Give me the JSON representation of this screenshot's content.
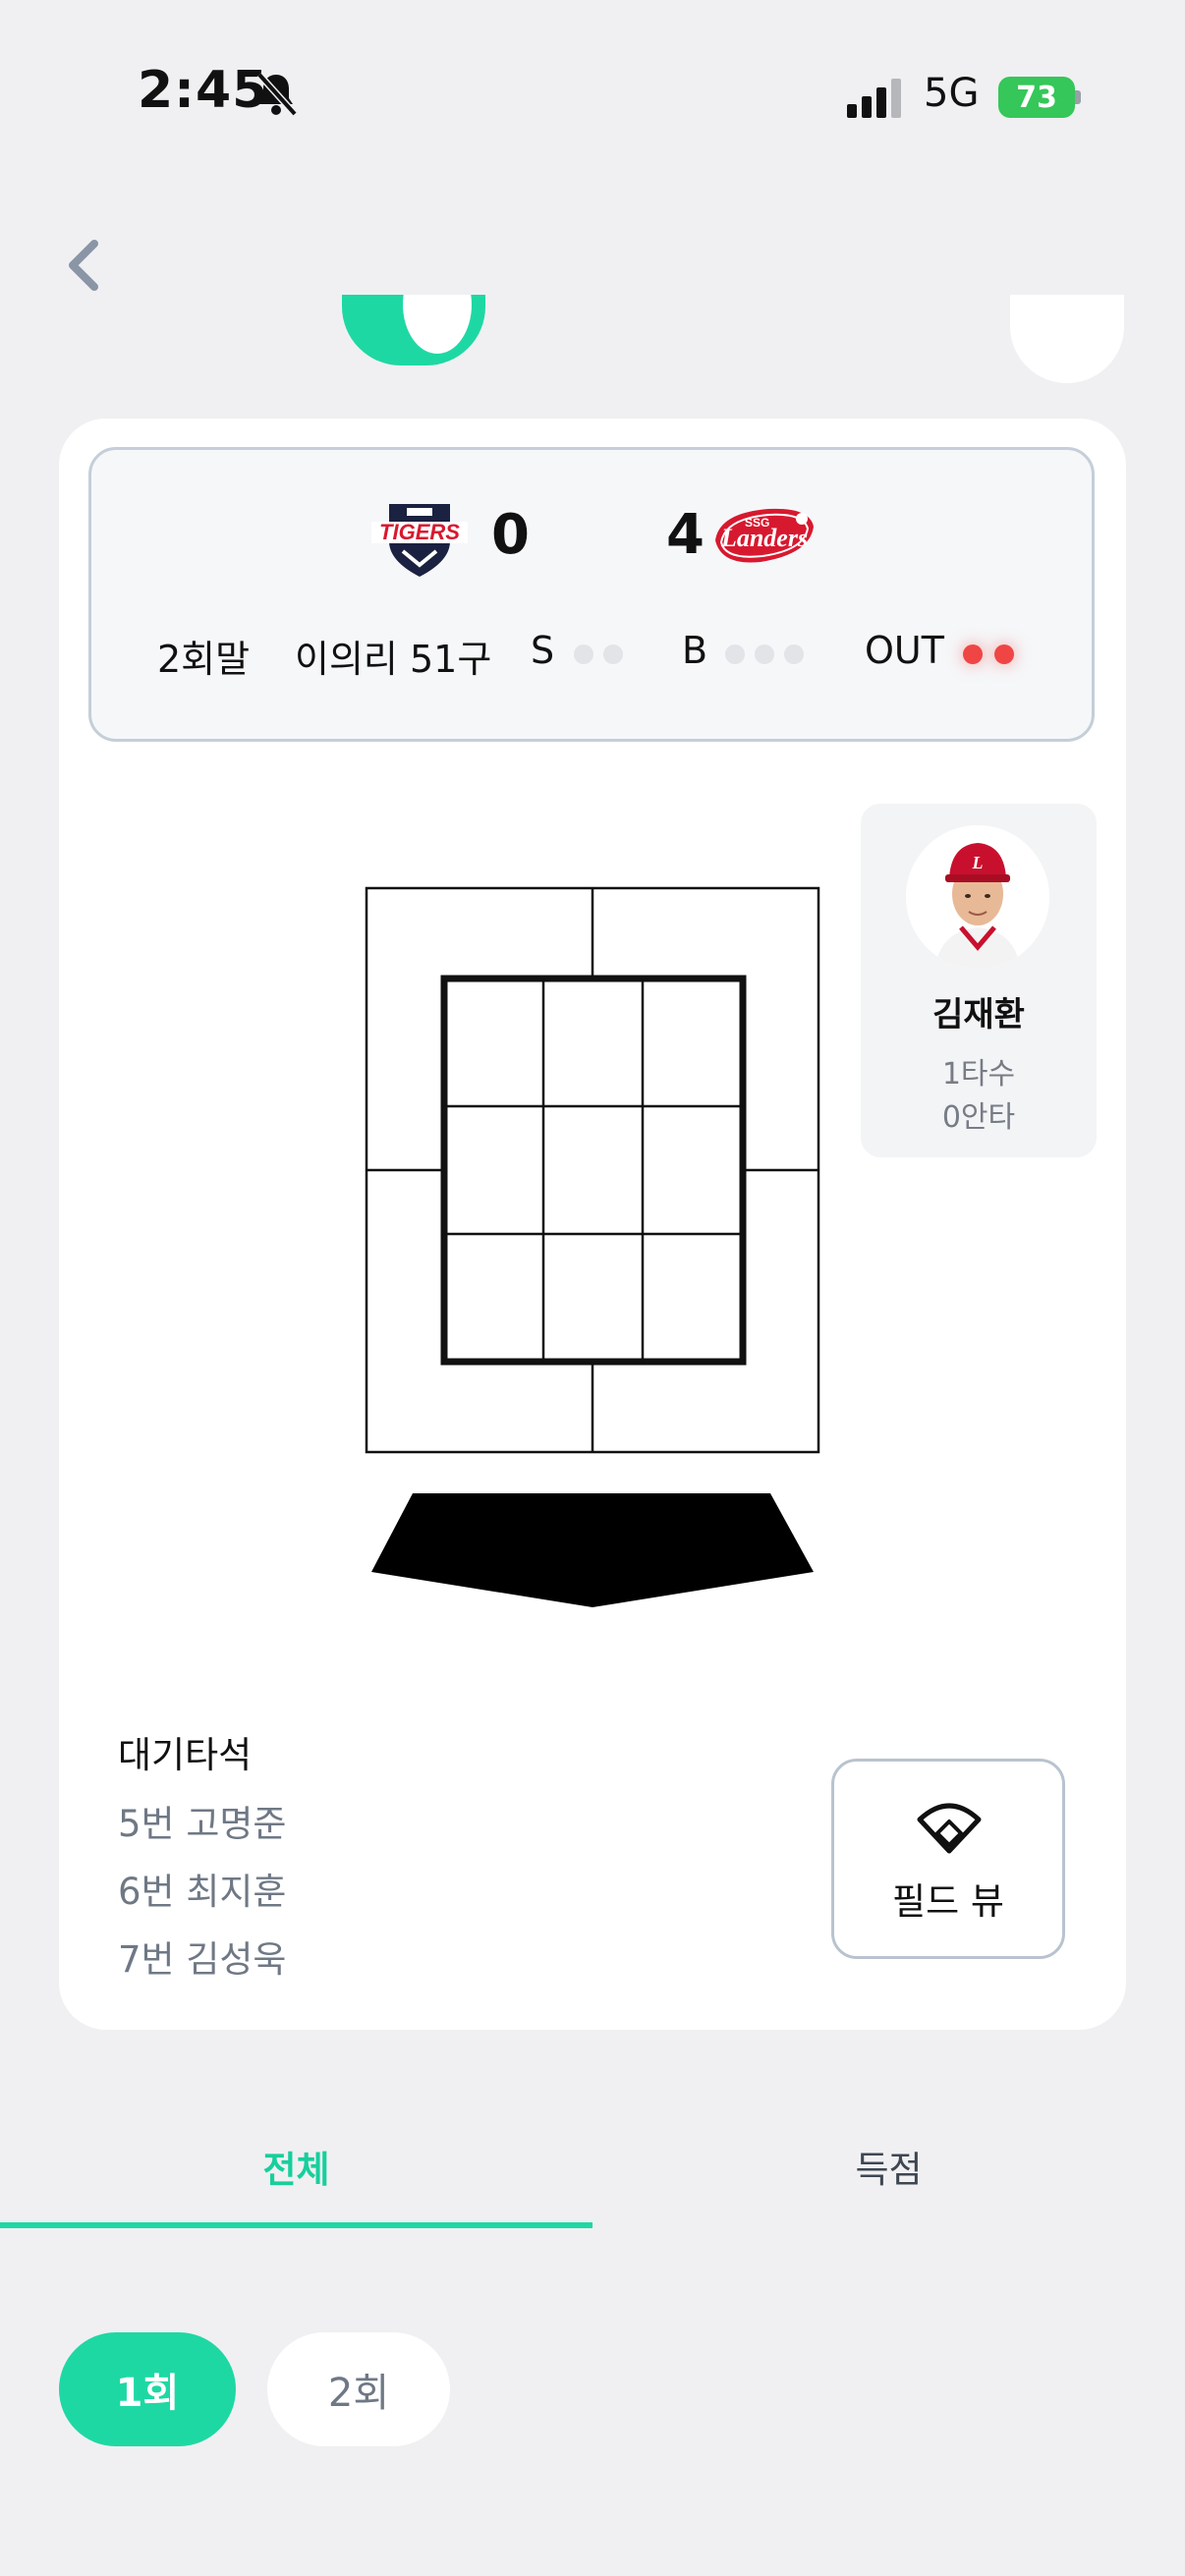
{
  "status_bar": {
    "time": "2:45",
    "network": "5G",
    "battery": "73"
  },
  "scoreboard": {
    "away_score": "0",
    "home_score": "4",
    "inning": "2회말",
    "pitcher_pitch": "이의리 51구",
    "strike_label": "S",
    "ball_label": "B",
    "out_label": "OUT",
    "strikes": 0,
    "balls": 0,
    "outs": 2,
    "colors": {
      "out_active": "#f04545",
      "inactive": "#e2e4e8"
    }
  },
  "batter": {
    "name": "김재환",
    "at_bats": "1타수",
    "hits": "0안타"
  },
  "on_deck": {
    "title": "대기타석",
    "items": [
      "5번 고명준",
      "6번 최지훈",
      "7번 김성욱"
    ]
  },
  "field_view": {
    "label": "필드 뷰",
    "icon": "baseball-field-icon"
  },
  "tabs": [
    {
      "label": "전체",
      "active": true
    },
    {
      "label": "득점",
      "active": false
    }
  ],
  "innings": [
    {
      "label": "1회",
      "active": true
    },
    {
      "label": "2회",
      "active": false
    }
  ],
  "accent_color": "#1ed8a4"
}
